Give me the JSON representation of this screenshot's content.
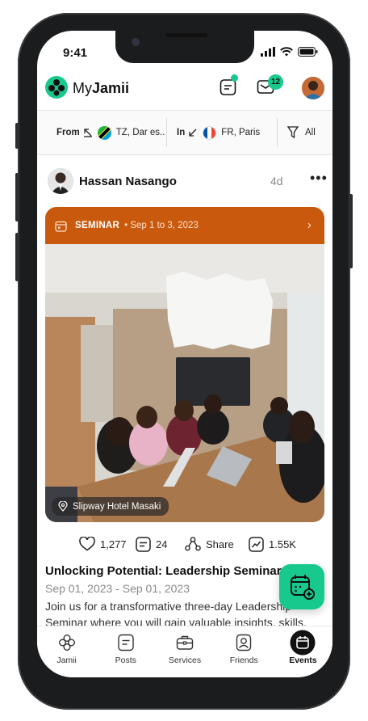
{
  "status": {
    "time": "9:41"
  },
  "app": {
    "brand_prefix": "My",
    "brand_bold": "Jamii",
    "messages_count": "12"
  },
  "filters": {
    "from_label": "From",
    "from_value": "TZ, Dar es..",
    "in_label": "In",
    "in_value": "FR, Paris",
    "all_label": "All"
  },
  "post": {
    "author": "Hassan Nasango",
    "age": "4d",
    "event_type": "SEMINAR",
    "event_dates": "• Sep 1 to 3, 2023",
    "venue": "Slipway Hotel Masaki",
    "likes": "1,277",
    "comments": "24",
    "share_label": "Share",
    "views": "1.55K",
    "title": "Unlocking Potential: Leadership Seminar",
    "date_range": "Sep 01, 2023 - Sep 01, 2023",
    "description": "Join us for a transformative three-day Leadership Seminar where you will gain valuable insights, skills,"
  },
  "tabs": [
    {
      "label": "Jamii",
      "icon": "jamii-icon"
    },
    {
      "label": "Posts",
      "icon": "posts-icon"
    },
    {
      "label": "Services",
      "icon": "briefcase-icon"
    },
    {
      "label": "Friends",
      "icon": "friends-icon"
    },
    {
      "label": "Events",
      "icon": "calendar-icon",
      "active": true
    }
  ],
  "colors": {
    "accent": "#18c98e",
    "event_header": "#c9590c"
  }
}
